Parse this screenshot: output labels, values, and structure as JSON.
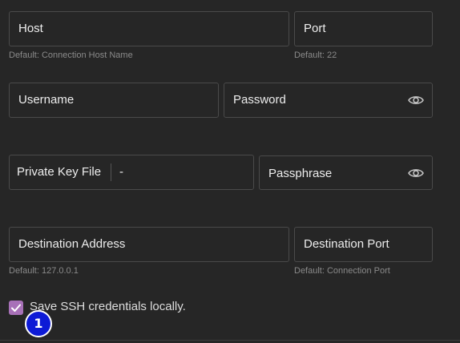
{
  "form": {
    "host": {
      "label": "Host",
      "hint": "Default: Connection Host Name"
    },
    "port": {
      "label": "Port",
      "hint": "Default: 22"
    },
    "username": {
      "label": "Username"
    },
    "password": {
      "label": "Password"
    },
    "private_key": {
      "label": "Private Key File",
      "value": "-"
    },
    "passphrase": {
      "label": "Passphrase"
    },
    "destination_address": {
      "label": "Destination Address",
      "hint": "Default: 127.0.0.1"
    },
    "destination_port": {
      "label": "Destination Port",
      "hint": "Default: Connection Port"
    },
    "save_credentials": {
      "label": "Save SSH credentials locally.",
      "checked": true
    }
  },
  "marker": {
    "number": "1",
    "color": "#0d1ad6"
  },
  "colors": {
    "background": "#262626",
    "border": "#4a4a4a",
    "checkbox": "#a871b8"
  },
  "icons": {
    "password_toggle": "eye-icon",
    "passphrase_toggle": "eye-icon",
    "checkbox_mark": "checkmark-icon"
  }
}
